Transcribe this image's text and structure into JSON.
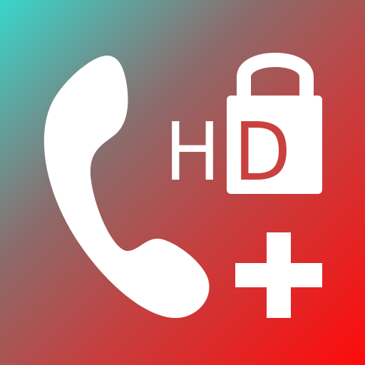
{
  "app_icon": {
    "hd_text_h": "H",
    "hd_text_d": "D",
    "colors": {
      "gradient_start": "#38d6cc",
      "gradient_mid": "#8a6c6c",
      "gradient_end": "#ff0a0a",
      "foreground": "#ffffff",
      "lock_letter": "#c9413f"
    },
    "icons": [
      "phone-handset-icon",
      "padlock-icon",
      "plus-icon"
    ]
  }
}
